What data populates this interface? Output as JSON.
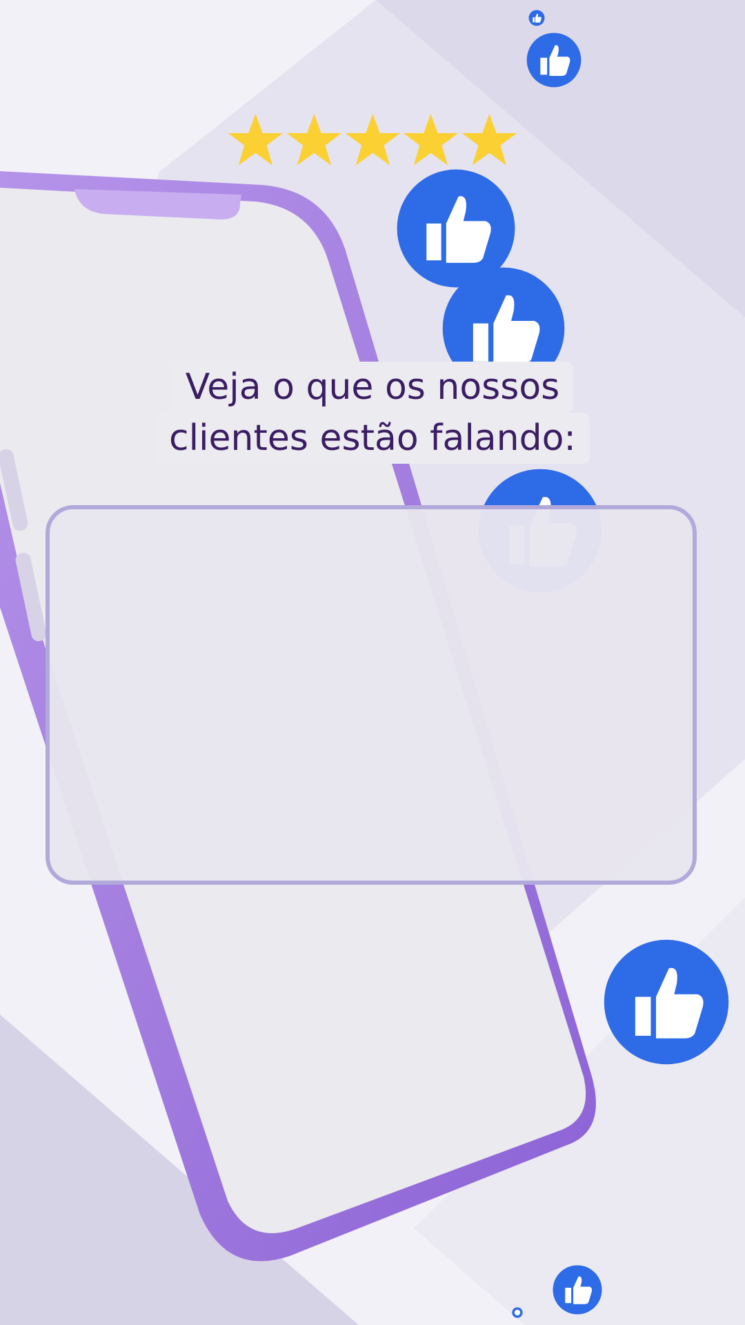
{
  "title": {
    "line1": "Veja o que os nossos",
    "line2": "clientes estão falando:"
  },
  "rating": {
    "stars": 5,
    "max": 5
  },
  "colors": {
    "background": "#f1f0f6",
    "diamond": "#d8d6e8",
    "phone_frame": "#a984e0",
    "phone_screen": "#ebeaee",
    "like_blue": "#2e6be6",
    "star_gold": "#fbd033",
    "title_text": "#3a1d63",
    "card_border": "#b2a9db"
  },
  "icons": {
    "star": "star-icon",
    "like": "thumbs-up-icon"
  },
  "testimonial_card": {
    "text": ""
  }
}
